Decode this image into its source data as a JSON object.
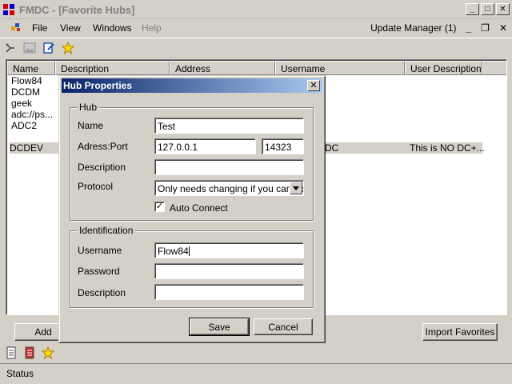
{
  "window": {
    "title": "FMDC - [Favorite Hubs]"
  },
  "menu": {
    "items": [
      "File",
      "View",
      "Windows",
      "Help"
    ],
    "update_manager": "Update Manager (1)"
  },
  "list": {
    "columns": [
      "Name",
      "Description",
      "Address",
      "Username",
      "User Description"
    ],
    "rows": [
      {
        "name": "Flow84",
        "username": "",
        "user_description": ""
      },
      {
        "name": "DCDM",
        "username": "",
        "user_description": ""
      },
      {
        "name": "geek",
        "username": "",
        "user_description": ""
      },
      {
        "name": "adc://ps...",
        "username": "",
        "user_description": ""
      },
      {
        "name": "ADC2",
        "username": "",
        "user_description": ""
      },
      {
        "name": "",
        "username": "",
        "user_description": ""
      },
      {
        "name": "DCDEV",
        "username": "DC",
        "user_description": "This is NO DC+..."
      }
    ]
  },
  "buttons": {
    "add": "Add",
    "import_favorites": "Import Favorites"
  },
  "status": {
    "text": "Status"
  },
  "dialog": {
    "title": "Hub Properties",
    "hub_group": "Hub",
    "name_label": "Name",
    "name_value": "Test",
    "address_label": "Adress:Port",
    "address_value": "127.0.0.1",
    "port_value": "14323",
    "description_label": "Description",
    "description_value": "",
    "protocol_label": "Protocol",
    "protocol_value": "Only needs changing if you cant log",
    "auto_connect_label": "Auto Connect",
    "auto_connect_checked": true,
    "identification_group": "Identification",
    "username_label": "Username",
    "username_value": "Flow84",
    "password_label": "Password",
    "password_value": "",
    "id_description_label": "Description",
    "id_description_value": "",
    "save": "Save",
    "cancel": "Cancel"
  },
  "colors": {
    "title_gradient_start": "#0a246a",
    "title_gradient_end": "#a6caf0",
    "face": "#d4d0c8"
  }
}
